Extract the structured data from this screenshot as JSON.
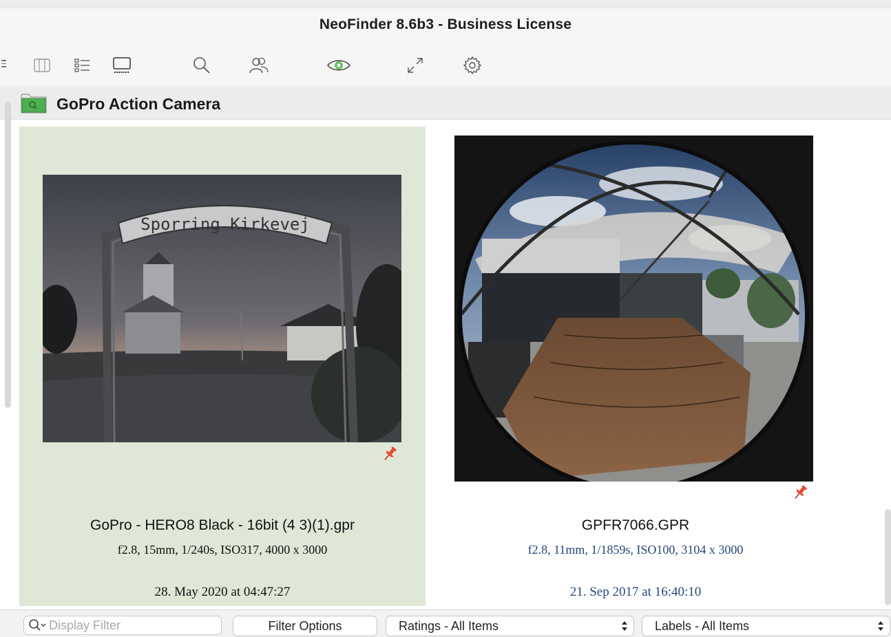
{
  "window": {
    "title": "NeoFinder 8.6b3 - Business License"
  },
  "toolbar": {
    "icons": [
      "columns-view-icon",
      "list-view-icon",
      "gallery-view-icon",
      "search-icon",
      "people-icon",
      "eye-icon",
      "fullscreen-icon",
      "gear-icon"
    ]
  },
  "folder": {
    "title": "GoPro Action Camera",
    "icon": "folder-search-icon",
    "accent": "#4caf50"
  },
  "items": [
    {
      "name": "GoPro - HERO8 Black - 16bit (4 3)(1).gpr",
      "meta": "f2.8, 15mm, 1/240s, ISO317, 4000 x 3000",
      "date": "28. May 2020 at 04:47:27",
      "selected": true,
      "sign_text": "Sporring Kirkevej",
      "pin_color": "#e8472a"
    },
    {
      "name": "GPFR7066.GPR",
      "meta": "f2.8, 11mm, 1/1859s, ISO100, 3104 x 3000",
      "date": "21. Sep 2017 at 16:40:10",
      "selected": false,
      "pin_color": "#e8472a"
    }
  ],
  "bottom": {
    "filter_placeholder": "Display Filter",
    "filter_value": "",
    "filter_options_label": "Filter Options",
    "ratings_label": "Ratings - All Items",
    "labels_label": "Labels - All Items"
  },
  "colors": {
    "selection": "#dfe8d7",
    "meta_link": "#24457a"
  }
}
